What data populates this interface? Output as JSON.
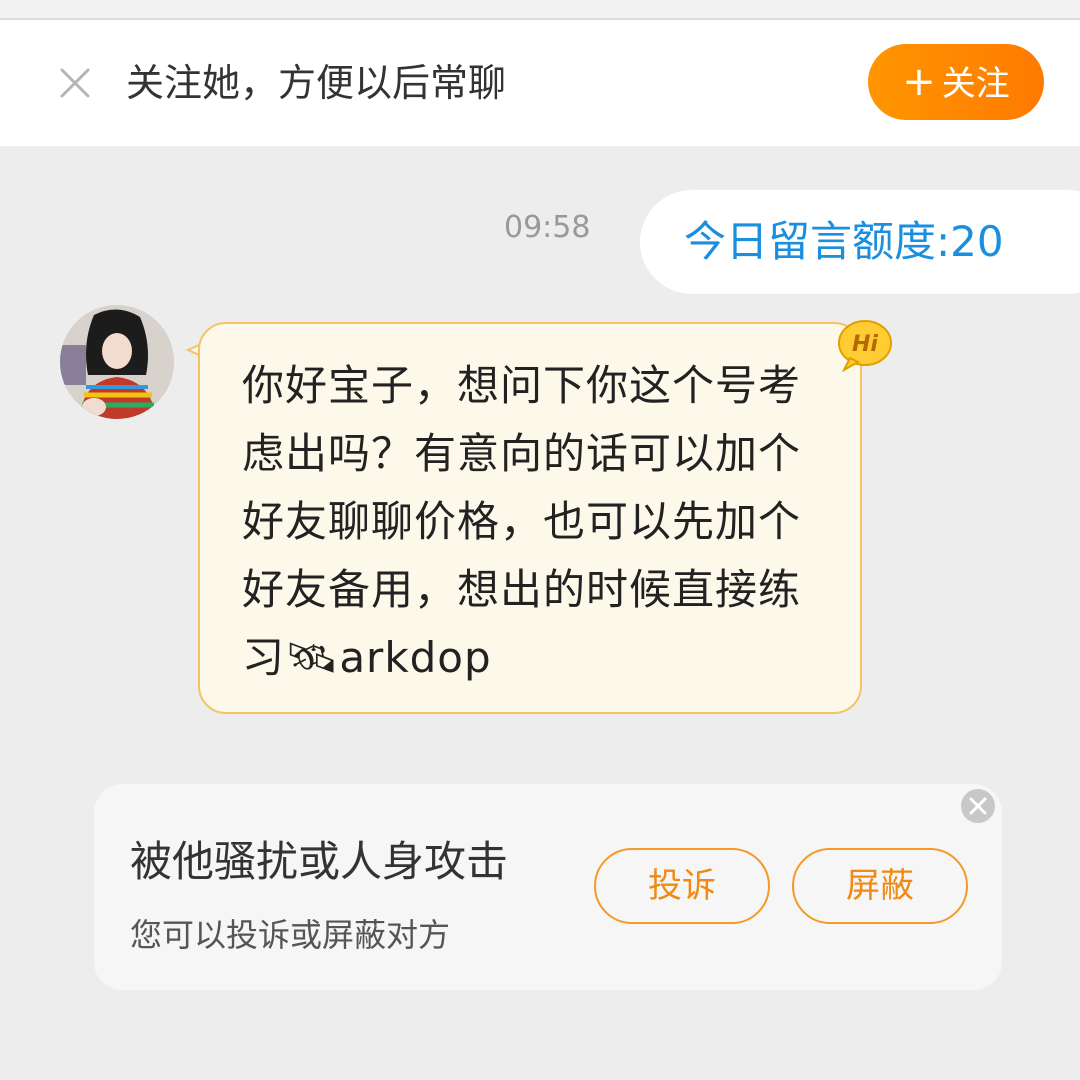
{
  "follow_bar": {
    "close_icon": "close-icon",
    "prompt": "关注她，方便以后常聊",
    "follow_button": {
      "plus": "+",
      "label": "关注"
    }
  },
  "chat": {
    "timestamp": "09:58",
    "quota_message": "今日留言额度:20",
    "incoming_message": {
      "avatar": "user-avatar",
      "text": "你好宝子，想问下你这个号考虑出吗？有意向的话可以加个好友聊聊价格，也可以先加个好友备用，想出的时候直接练习🛰arkdop",
      "badge": "Hi"
    }
  },
  "report_card": {
    "title": "被他骚扰或人身攻击",
    "subtitle": "您可以投诉或屏蔽对方",
    "complain_label": "投诉",
    "block_label": "屏蔽"
  },
  "colors": {
    "accent_orange": "#ff8a00",
    "quota_blue": "#1a8fe0",
    "bubble_bg": "#fdf9ea",
    "bubble_border": "#f3c463"
  }
}
